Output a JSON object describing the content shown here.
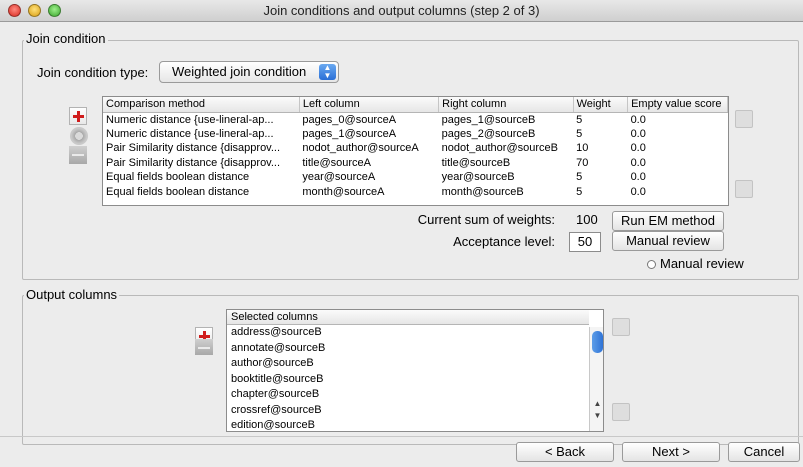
{
  "window": {
    "title": "Join conditions and output columns (step 2 of 3)"
  },
  "join": {
    "legend": "Join condition",
    "type_label": "Join condition type:",
    "type_value": "Weighted join condition",
    "columns": [
      "Comparison method",
      "Left column",
      "Right column",
      "Weight",
      "Empty value score"
    ],
    "rows": [
      [
        "Numeric distance {use-lineral-ap...",
        "pages_0@sourceA",
        "pages_1@sourceB",
        "5",
        "0.0"
      ],
      [
        "Numeric distance {use-lineral-ap...",
        "pages_1@sourceA",
        "pages_2@sourceB",
        "5",
        "0.0"
      ],
      [
        "Pair Similarity distance {disapprov...",
        "nodot_author@sourceA",
        "nodot_author@sourceB",
        "10",
        "0.0"
      ],
      [
        "Pair Similarity distance {disapprov...",
        "title@sourceA",
        "title@sourceB",
        "70",
        "0.0"
      ],
      [
        "Equal fields boolean distance",
        "year@sourceA",
        "year@sourceB",
        "5",
        "0.0"
      ],
      [
        "Equal fields boolean distance",
        "month@sourceA",
        "month@sourceB",
        "5",
        "0.0"
      ]
    ],
    "sum_label": "Current sum of weights:",
    "sum_value": "100",
    "acceptance_label": "Acceptance level:",
    "acceptance_value": "50",
    "run_em_label": "Run EM method",
    "manual_review_button": "Manual review",
    "manual_review_radio": "Manual review"
  },
  "output": {
    "legend": "Output columns",
    "header": "Selected columns",
    "items": [
      "address@sourceB",
      "annotate@sourceB",
      "author@sourceB",
      "booktitle@sourceB",
      "chapter@sourceB",
      "crossref@sourceB",
      "edition@sourceB"
    ]
  },
  "footer": {
    "back": "< Back",
    "next": "Next >",
    "cancel": "Cancel"
  },
  "icons": [
    "add-icon",
    "gear-icon",
    "remove-icon",
    "move-up-icon",
    "move-down-icon"
  ]
}
